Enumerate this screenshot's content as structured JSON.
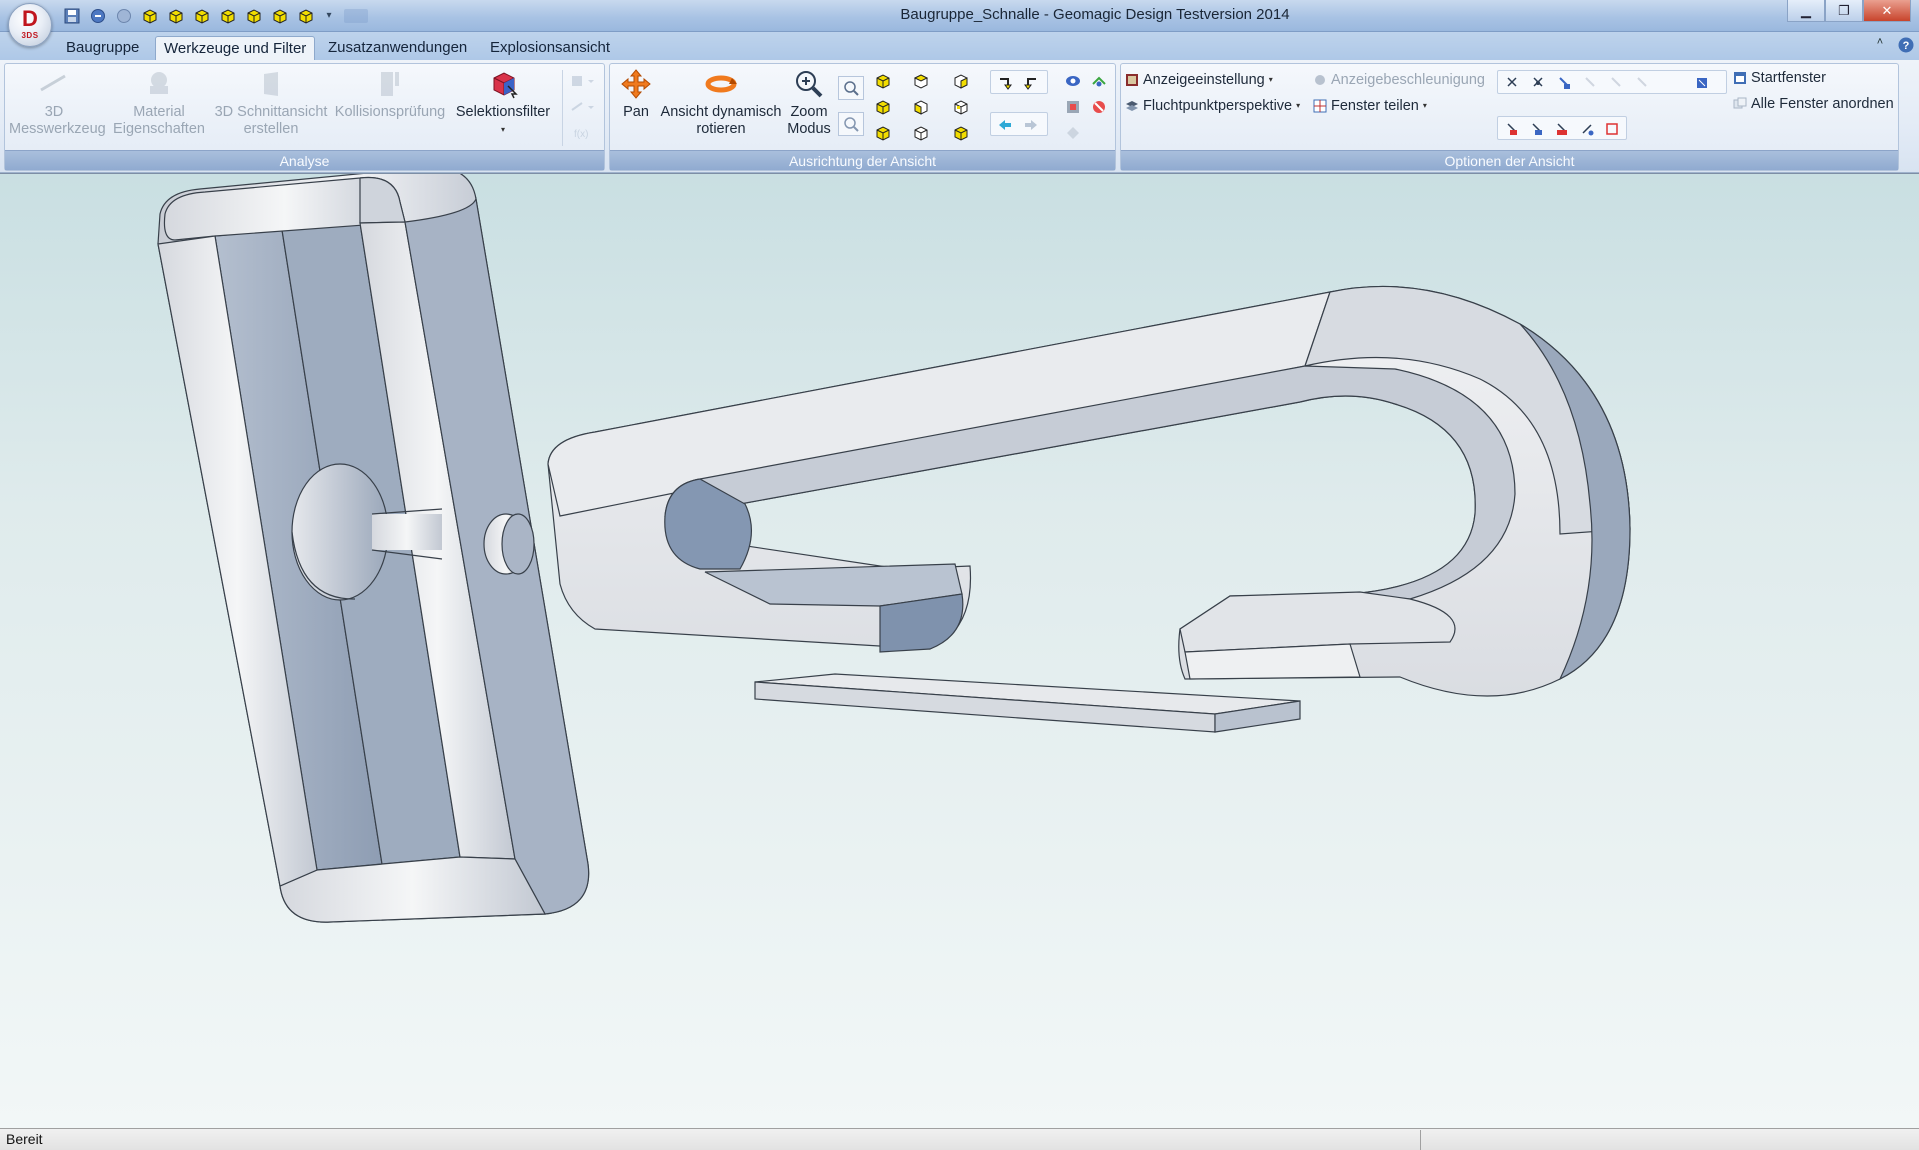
{
  "window": {
    "title": "Baugruppe_Schnalle - Geomagic Design Testversion 2014",
    "app_logo_letter": "D",
    "app_logo_sub": "3DS",
    "controls": {
      "minimize": "▁",
      "maximize": "❐",
      "close": "✕"
    }
  },
  "quick_access": {
    "icons": [
      "save-icon",
      "undo-icon",
      "redo-icon",
      "view-cube-icon",
      "view-cube-icon",
      "view-cube-icon",
      "view-cube-icon",
      "view-cube-icon",
      "view-cube-icon",
      "view-cube-icon"
    ],
    "more": "▾"
  },
  "tabs": [
    {
      "label": "Baugruppe",
      "active": false
    },
    {
      "label": "Werkzeuge und Filter",
      "active": true
    },
    {
      "label": "Zusatzanwendungen",
      "active": false
    },
    {
      "label": "Explosionsansicht",
      "active": false
    }
  ],
  "ribbon_minimize": "˄",
  "groups": {
    "analyse": {
      "label": "Analyse",
      "buttons": {
        "measure_line1": "3D",
        "measure_line2": "Messwerkzeug",
        "material_line1": "Material",
        "material_line2": "Eigenschaften",
        "section_line1": "3D Schnittansicht",
        "section_line2": "erstellen",
        "collision": "Kollisionsprüfung",
        "selection_filter": "Selektionsfilter",
        "selection_dd": "▾"
      }
    },
    "ausrichtung": {
      "label": "Ausrichtung der Ansicht",
      "buttons": {
        "pan": "Pan",
        "rotate_line1": "Ansicht dynamisch",
        "rotate_line2": "rotieren",
        "zoom_line1": "Zoom",
        "zoom_line2": "Modus"
      }
    },
    "optionen": {
      "label": "Optionen der Ansicht",
      "buttons": {
        "display_settings": "Anzeigeeinstellung",
        "perspective": "Fluchtpunktperspektive",
        "acceleration": "Anzeigebeschleunigung",
        "split_window": "Fenster teilen",
        "start_window": "Startfenster",
        "arrange_windows": "Alle Fenster anordnen"
      }
    }
  },
  "colors": {
    "accent": "#3f6eb5",
    "pan_orange": "#f07a1e",
    "cube_yellow": "#f2dd00",
    "part_light": "#e8e9ec",
    "part_shadow": "#8d9cb2",
    "part_edge": "#38404a"
  },
  "status": {
    "text": "Bereit"
  }
}
